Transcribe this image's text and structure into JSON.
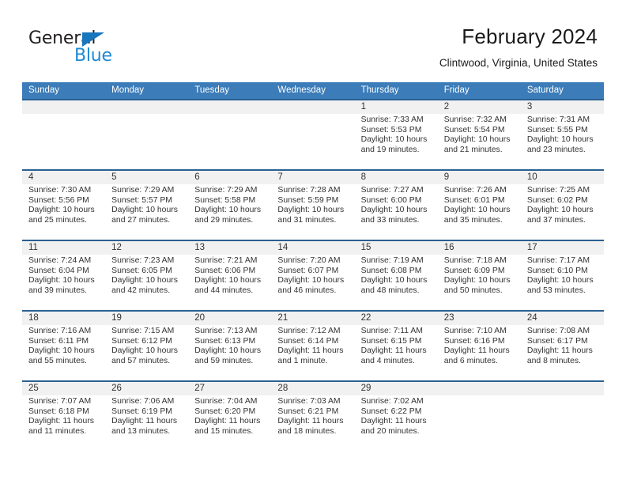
{
  "brand": {
    "name_top": "General",
    "name_bottom": "Blue",
    "triangle_color": "#1975bc",
    "blue_text_color": "#1f88d4"
  },
  "header": {
    "title": "February 2024",
    "subtitle": "Clintwood, Virginia, United States",
    "accent_color": "#3b7cb9",
    "row_border_color": "#2b5f92",
    "daynum_band_color": "#f1f1f1"
  },
  "weekdays": [
    "Sunday",
    "Monday",
    "Tuesday",
    "Wednesday",
    "Thursday",
    "Friday",
    "Saturday"
  ],
  "weeks": [
    [
      {
        "day": "",
        "sunrise": "",
        "sunset": "",
        "daylight_line1": "",
        "daylight_line2": ""
      },
      {
        "day": "",
        "sunrise": "",
        "sunset": "",
        "daylight_line1": "",
        "daylight_line2": ""
      },
      {
        "day": "",
        "sunrise": "",
        "sunset": "",
        "daylight_line1": "",
        "daylight_line2": ""
      },
      {
        "day": "",
        "sunrise": "",
        "sunset": "",
        "daylight_line1": "",
        "daylight_line2": ""
      },
      {
        "day": "1",
        "sunrise": "Sunrise: 7:33 AM",
        "sunset": "Sunset: 5:53 PM",
        "daylight_line1": "Daylight: 10 hours",
        "daylight_line2": "and 19 minutes."
      },
      {
        "day": "2",
        "sunrise": "Sunrise: 7:32 AM",
        "sunset": "Sunset: 5:54 PM",
        "daylight_line1": "Daylight: 10 hours",
        "daylight_line2": "and 21 minutes."
      },
      {
        "day": "3",
        "sunrise": "Sunrise: 7:31 AM",
        "sunset": "Sunset: 5:55 PM",
        "daylight_line1": "Daylight: 10 hours",
        "daylight_line2": "and 23 minutes."
      }
    ],
    [
      {
        "day": "4",
        "sunrise": "Sunrise: 7:30 AM",
        "sunset": "Sunset: 5:56 PM",
        "daylight_line1": "Daylight: 10 hours",
        "daylight_line2": "and 25 minutes."
      },
      {
        "day": "5",
        "sunrise": "Sunrise: 7:29 AM",
        "sunset": "Sunset: 5:57 PM",
        "daylight_line1": "Daylight: 10 hours",
        "daylight_line2": "and 27 minutes."
      },
      {
        "day": "6",
        "sunrise": "Sunrise: 7:29 AM",
        "sunset": "Sunset: 5:58 PM",
        "daylight_line1": "Daylight: 10 hours",
        "daylight_line2": "and 29 minutes."
      },
      {
        "day": "7",
        "sunrise": "Sunrise: 7:28 AM",
        "sunset": "Sunset: 5:59 PM",
        "daylight_line1": "Daylight: 10 hours",
        "daylight_line2": "and 31 minutes."
      },
      {
        "day": "8",
        "sunrise": "Sunrise: 7:27 AM",
        "sunset": "Sunset: 6:00 PM",
        "daylight_line1": "Daylight: 10 hours",
        "daylight_line2": "and 33 minutes."
      },
      {
        "day": "9",
        "sunrise": "Sunrise: 7:26 AM",
        "sunset": "Sunset: 6:01 PM",
        "daylight_line1": "Daylight: 10 hours",
        "daylight_line2": "and 35 minutes."
      },
      {
        "day": "10",
        "sunrise": "Sunrise: 7:25 AM",
        "sunset": "Sunset: 6:02 PM",
        "daylight_line1": "Daylight: 10 hours",
        "daylight_line2": "and 37 minutes."
      }
    ],
    [
      {
        "day": "11",
        "sunrise": "Sunrise: 7:24 AM",
        "sunset": "Sunset: 6:04 PM",
        "daylight_line1": "Daylight: 10 hours",
        "daylight_line2": "and 39 minutes."
      },
      {
        "day": "12",
        "sunrise": "Sunrise: 7:23 AM",
        "sunset": "Sunset: 6:05 PM",
        "daylight_line1": "Daylight: 10 hours",
        "daylight_line2": "and 42 minutes."
      },
      {
        "day": "13",
        "sunrise": "Sunrise: 7:21 AM",
        "sunset": "Sunset: 6:06 PM",
        "daylight_line1": "Daylight: 10 hours",
        "daylight_line2": "and 44 minutes."
      },
      {
        "day": "14",
        "sunrise": "Sunrise: 7:20 AM",
        "sunset": "Sunset: 6:07 PM",
        "daylight_line1": "Daylight: 10 hours",
        "daylight_line2": "and 46 minutes."
      },
      {
        "day": "15",
        "sunrise": "Sunrise: 7:19 AM",
        "sunset": "Sunset: 6:08 PM",
        "daylight_line1": "Daylight: 10 hours",
        "daylight_line2": "and 48 minutes."
      },
      {
        "day": "16",
        "sunrise": "Sunrise: 7:18 AM",
        "sunset": "Sunset: 6:09 PM",
        "daylight_line1": "Daylight: 10 hours",
        "daylight_line2": "and 50 minutes."
      },
      {
        "day": "17",
        "sunrise": "Sunrise: 7:17 AM",
        "sunset": "Sunset: 6:10 PM",
        "daylight_line1": "Daylight: 10 hours",
        "daylight_line2": "and 53 minutes."
      }
    ],
    [
      {
        "day": "18",
        "sunrise": "Sunrise: 7:16 AM",
        "sunset": "Sunset: 6:11 PM",
        "daylight_line1": "Daylight: 10 hours",
        "daylight_line2": "and 55 minutes."
      },
      {
        "day": "19",
        "sunrise": "Sunrise: 7:15 AM",
        "sunset": "Sunset: 6:12 PM",
        "daylight_line1": "Daylight: 10 hours",
        "daylight_line2": "and 57 minutes."
      },
      {
        "day": "20",
        "sunrise": "Sunrise: 7:13 AM",
        "sunset": "Sunset: 6:13 PM",
        "daylight_line1": "Daylight: 10 hours",
        "daylight_line2": "and 59 minutes."
      },
      {
        "day": "21",
        "sunrise": "Sunrise: 7:12 AM",
        "sunset": "Sunset: 6:14 PM",
        "daylight_line1": "Daylight: 11 hours",
        "daylight_line2": "and 1 minute."
      },
      {
        "day": "22",
        "sunrise": "Sunrise: 7:11 AM",
        "sunset": "Sunset: 6:15 PM",
        "daylight_line1": "Daylight: 11 hours",
        "daylight_line2": "and 4 minutes."
      },
      {
        "day": "23",
        "sunrise": "Sunrise: 7:10 AM",
        "sunset": "Sunset: 6:16 PM",
        "daylight_line1": "Daylight: 11 hours",
        "daylight_line2": "and 6 minutes."
      },
      {
        "day": "24",
        "sunrise": "Sunrise: 7:08 AM",
        "sunset": "Sunset: 6:17 PM",
        "daylight_line1": "Daylight: 11 hours",
        "daylight_line2": "and 8 minutes."
      }
    ],
    [
      {
        "day": "25",
        "sunrise": "Sunrise: 7:07 AM",
        "sunset": "Sunset: 6:18 PM",
        "daylight_line1": "Daylight: 11 hours",
        "daylight_line2": "and 11 minutes."
      },
      {
        "day": "26",
        "sunrise": "Sunrise: 7:06 AM",
        "sunset": "Sunset: 6:19 PM",
        "daylight_line1": "Daylight: 11 hours",
        "daylight_line2": "and 13 minutes."
      },
      {
        "day": "27",
        "sunrise": "Sunrise: 7:04 AM",
        "sunset": "Sunset: 6:20 PM",
        "daylight_line1": "Daylight: 11 hours",
        "daylight_line2": "and 15 minutes."
      },
      {
        "day": "28",
        "sunrise": "Sunrise: 7:03 AM",
        "sunset": "Sunset: 6:21 PM",
        "daylight_line1": "Daylight: 11 hours",
        "daylight_line2": "and 18 minutes."
      },
      {
        "day": "29",
        "sunrise": "Sunrise: 7:02 AM",
        "sunset": "Sunset: 6:22 PM",
        "daylight_line1": "Daylight: 11 hours",
        "daylight_line2": "and 20 minutes."
      },
      {
        "day": "",
        "sunrise": "",
        "sunset": "",
        "daylight_line1": "",
        "daylight_line2": ""
      },
      {
        "day": "",
        "sunrise": "",
        "sunset": "",
        "daylight_line1": "",
        "daylight_line2": ""
      }
    ]
  ]
}
